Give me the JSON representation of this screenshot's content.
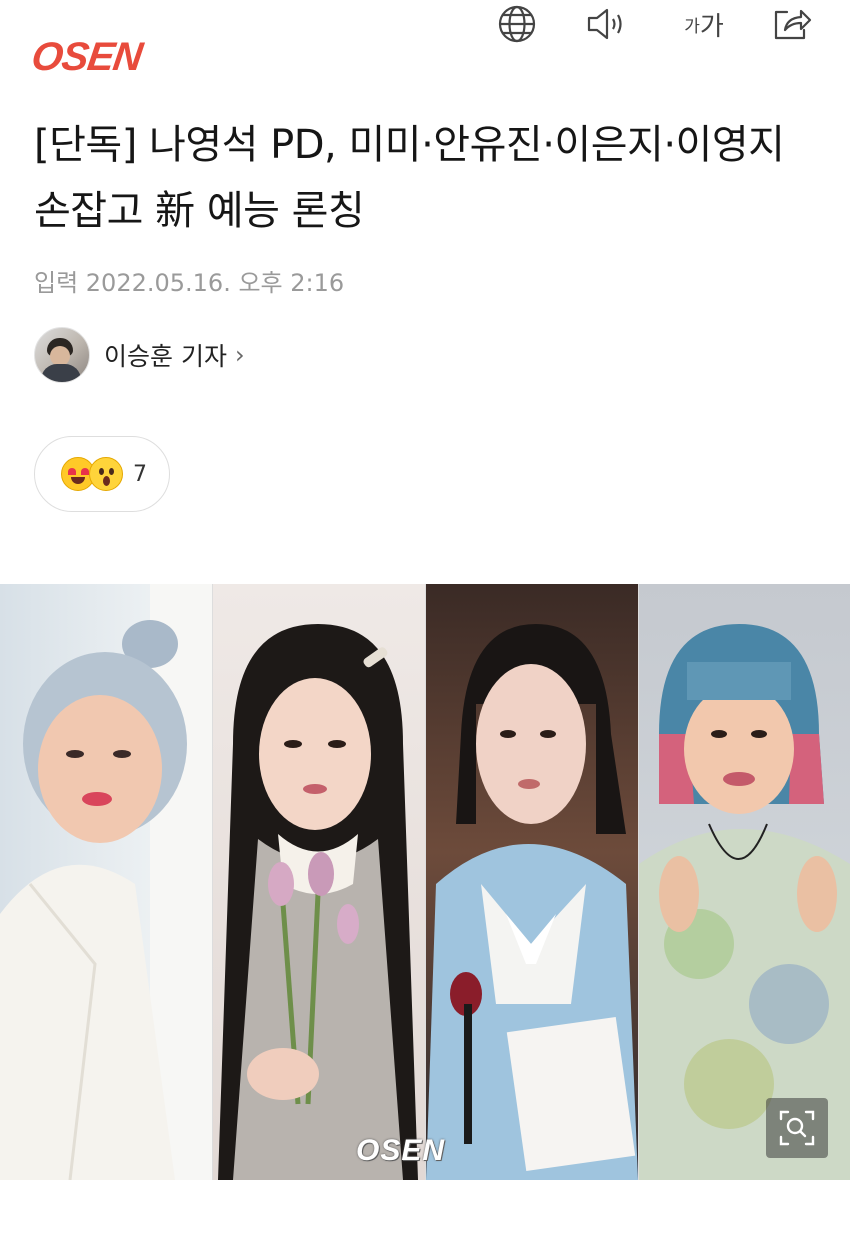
{
  "header": {
    "logo": "OSEN"
  },
  "article": {
    "title": "[단독] 나영석 PD, 미미·안유진·이은지·이영지 손잡고 新 예능 론칭",
    "date": "입력 2022.05.16. 오후 2:16",
    "reporter": "이승훈 기자",
    "reporter_chevron": "›"
  },
  "reaction": {
    "count": "7"
  },
  "toolbar": {
    "font_small": "가",
    "font_large": "가",
    "icons": [
      "globe-icon",
      "speaker-icon",
      "font-size-icon",
      "share-icon"
    ]
  },
  "photo": {
    "watermark": "OSEN"
  },
  "colors": {
    "brand": "#e84b3c",
    "meta": "#9a9a9a"
  }
}
